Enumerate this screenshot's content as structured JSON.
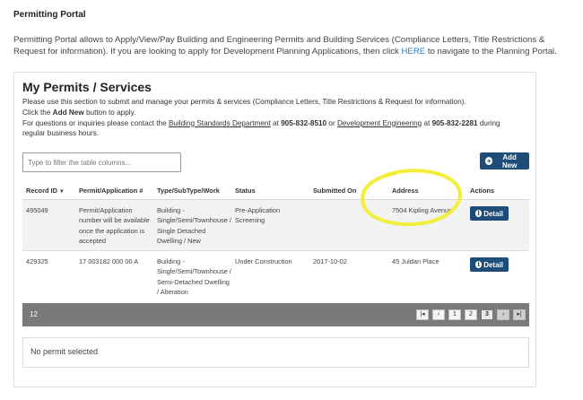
{
  "page": {
    "title": "Permitting Portal",
    "intro_before_link": "Permitting Portal allows to Apply/View/Pay Building and Engineering Permits and Building Services (Compliance Letters, Title Restrictions & Request for information). If you are looking to apply for Development Planning Applications, then click ",
    "intro_link": "HERE",
    "intro_after_link": " to navigate to the Planning Portal."
  },
  "card": {
    "title": "My Permits / Services",
    "line1": "Please use this section to submit and manage your permits & services (Compliance Letters, Title Restrictions & Request for information).",
    "line2_pre": "Click the ",
    "line2_bold": "Add New",
    "line2_post": " button to apply.",
    "line3_pre": "For questions or inquiries please contact the ",
    "line3_link1": "Building Standards Department",
    "line3_mid1": " at ",
    "line3_phone1": "905-832-8510",
    "line3_mid2": " or ",
    "line3_link2": "Development Engineering",
    "line3_mid3": " at ",
    "line3_phone2": "905-832-2281",
    "line3_post": " during regular business hours."
  },
  "filter": {
    "placeholder": "Type to filter the table columns..."
  },
  "add_button": {
    "icon": "plus-circle-icon",
    "label": "Add New"
  },
  "table": {
    "headers": {
      "record_id": "Record ID",
      "permit": "Permit/Application #",
      "type": "Type/SubType/Work",
      "status": "Status",
      "submitted": "Submitted On",
      "address": "Address",
      "actions": "Actions"
    },
    "rows": [
      {
        "record_id": "495049",
        "permit": "Permit/Application number will be available once the application is accepted",
        "type": "Building - Single/Semi/Townhouse / Single Detached Dwelling / New",
        "status": "Pre-Application Screening",
        "submitted": "",
        "address": "7504 Kipling Avenue",
        "action_label": "Detail"
      },
      {
        "record_id": "429325",
        "permit": "17 003182 000 00 A",
        "type": "Building - Single/Semi/Townhouse / Semi-Detached Dwelling / Alteration",
        "status": "Under Construction",
        "submitted": "2017-10-02",
        "address": "45 Juldan Place",
        "action_label": "Detail"
      }
    ]
  },
  "footer": {
    "count": "12",
    "pages": [
      "1",
      "2",
      "3"
    ],
    "active_page": "3"
  },
  "selection": {
    "text": "No permit selected"
  },
  "colors": {
    "primary": "#1e4d79",
    "link": "#2a7fbf",
    "highlight": "#f2ee3a",
    "footer_bar": "#7a7a7a"
  }
}
